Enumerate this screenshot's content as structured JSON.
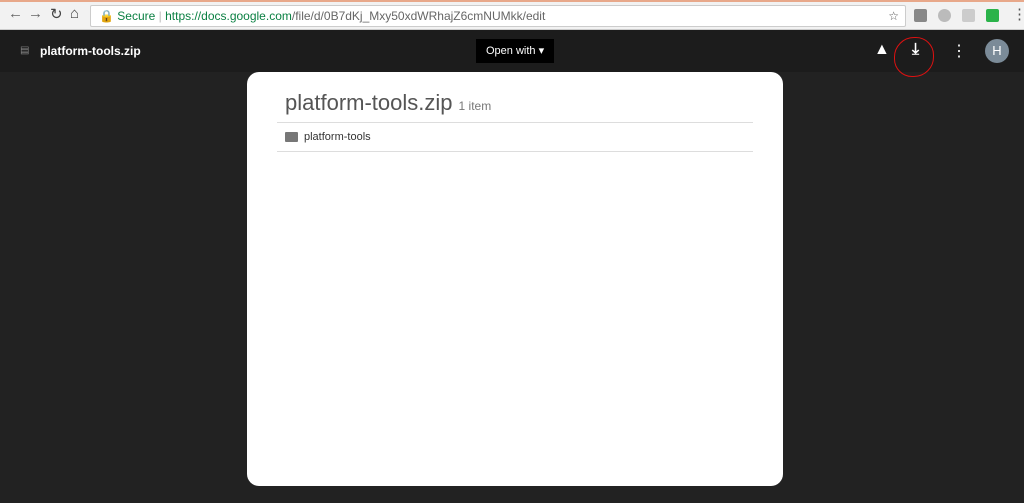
{
  "browser": {
    "secure_label": "Secure",
    "url_host": "https://docs.google.com",
    "url_path": "/file/d/0B7dKj_Mxy50xdWRhajZ6cmNUMkk/edit"
  },
  "topbar": {
    "file_title": "platform-tools.zip",
    "open_with": "Open with",
    "avatar_initial": "H"
  },
  "card": {
    "title": "platform-tools.zip",
    "count": "1 item",
    "items": [
      {
        "name": "platform-tools"
      }
    ]
  },
  "colors": {
    "annotation": "#dd1111",
    "secure": "#0b8043"
  }
}
